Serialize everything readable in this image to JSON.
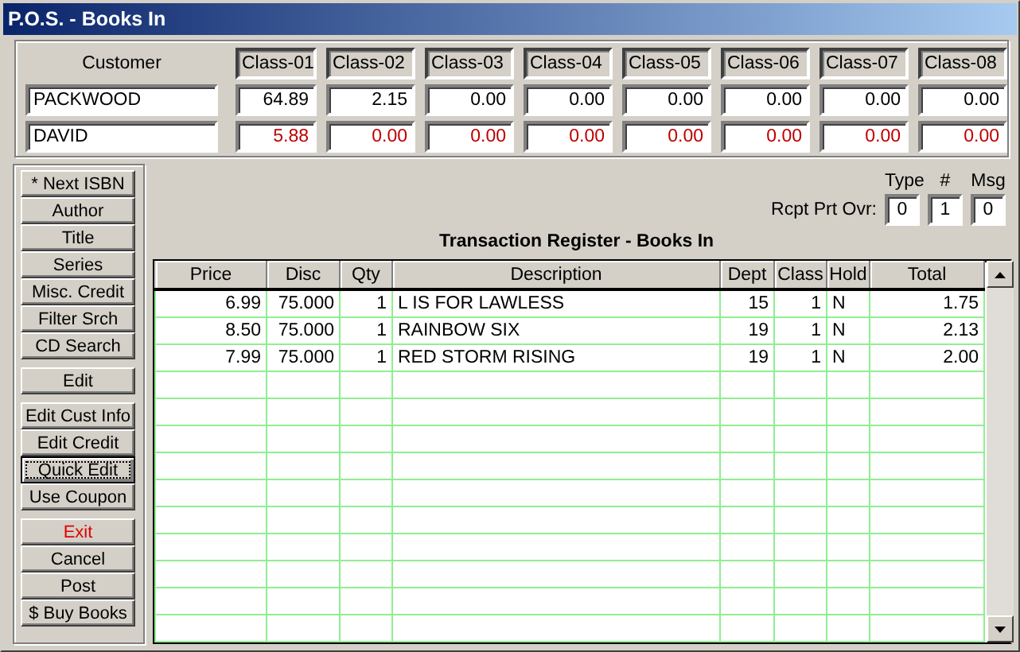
{
  "window": {
    "title": "P.O.S. - Books In"
  },
  "customer": {
    "label": "Customer",
    "name_lines": [
      "PACKWOOD",
      "DAVID"
    ],
    "classes": [
      "Class-01",
      "Class-02",
      "Class-03",
      "Class-04",
      "Class-05",
      "Class-06",
      "Class-07",
      "Class-08"
    ],
    "rows": [
      {
        "color": "#000000",
        "values": [
          "64.89",
          "2.15",
          "0.00",
          "0.00",
          "0.00",
          "0.00",
          "0.00",
          "0.00"
        ]
      },
      {
        "color": "#c00000",
        "values": [
          "5.88",
          "0.00",
          "0.00",
          "0.00",
          "0.00",
          "0.00",
          "0.00",
          "0.00"
        ]
      }
    ]
  },
  "button_groups": [
    [
      {
        "label": "* Next ISBN",
        "alert": false,
        "focused": false
      },
      {
        "label": "Author",
        "alert": false,
        "focused": false
      },
      {
        "label": "Title",
        "alert": false,
        "focused": false
      },
      {
        "label": "Series",
        "alert": false,
        "focused": false
      },
      {
        "label": "Misc. Credit",
        "alert": false,
        "focused": false
      },
      {
        "label": "Filter Srch",
        "alert": false,
        "focused": false
      },
      {
        "label": "CD Search",
        "alert": false,
        "focused": false
      }
    ],
    [
      {
        "label": "Edit",
        "alert": false,
        "focused": false
      }
    ],
    [
      {
        "label": "Edit Cust Info",
        "alert": false,
        "focused": false
      },
      {
        "label": "Edit Credit",
        "alert": false,
        "focused": false
      },
      {
        "label": "Quick Edit",
        "alert": false,
        "focused": true
      },
      {
        "label": "Use Coupon",
        "alert": false,
        "focused": false
      }
    ],
    [
      {
        "label": "Exit",
        "alert": true,
        "focused": false
      },
      {
        "label": "Cancel",
        "alert": false,
        "focused": false
      },
      {
        "label": "Post",
        "alert": false,
        "focused": false
      },
      {
        "label": "$ Buy Books",
        "alert": false,
        "focused": false
      }
    ]
  ],
  "receipt_override": {
    "label": "Rcpt Prt Ovr:",
    "fields": [
      {
        "heading": "Type",
        "value": "0"
      },
      {
        "heading": "#",
        "value": "1"
      },
      {
        "heading": "Msg",
        "value": "0"
      }
    ]
  },
  "register": {
    "title": "Transaction Register - Books In",
    "columns": [
      "Price",
      "Disc",
      "Qty",
      "Description",
      "Dept",
      "Class",
      "Hold",
      "Total"
    ],
    "rows": [
      [
        "6.99",
        "75.000",
        "1",
        "L IS FOR LAWLESS",
        "15",
        "1",
        "N",
        "1.75"
      ],
      [
        "8.50",
        "75.000",
        "1",
        "RAINBOW SIX",
        "19",
        "1",
        "N",
        "2.13"
      ],
      [
        "7.99",
        "75.000",
        "1",
        "RED STORM RISING",
        "19",
        "1",
        "N",
        "2.00"
      ]
    ]
  }
}
